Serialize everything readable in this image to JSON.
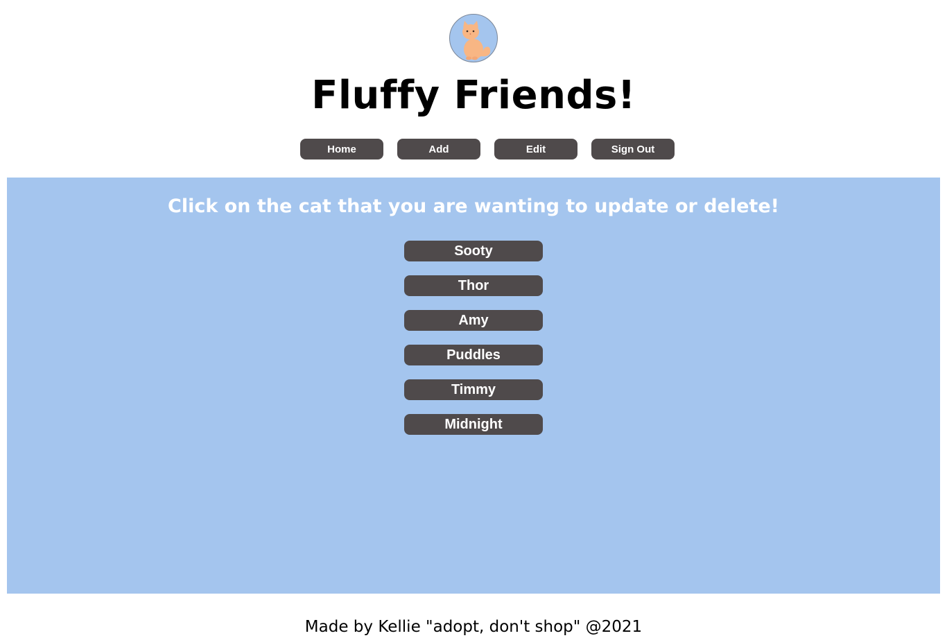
{
  "header": {
    "logo_icon": "cat-logo-icon",
    "title": "Fluffy Friends!"
  },
  "nav": {
    "items": [
      {
        "label": "Home"
      },
      {
        "label": "Add"
      },
      {
        "label": "Edit"
      },
      {
        "label": "Sign Out"
      }
    ]
  },
  "main": {
    "instruction": "Click on the cat that you are wanting to update or delete!",
    "cats": [
      {
        "name": "Sooty"
      },
      {
        "name": "Thor"
      },
      {
        "name": "Amy"
      },
      {
        "name": "Puddles"
      },
      {
        "name": "Timmy"
      },
      {
        "name": "Midnight"
      }
    ]
  },
  "footer": {
    "text": "Made by Kellie \"adopt, don't shop\" @2021"
  },
  "colors": {
    "panel_background": "#a4c5ee",
    "button_background": "#4f4a4b",
    "button_text": "#ffffff",
    "cat_fill": "#f8b684"
  }
}
